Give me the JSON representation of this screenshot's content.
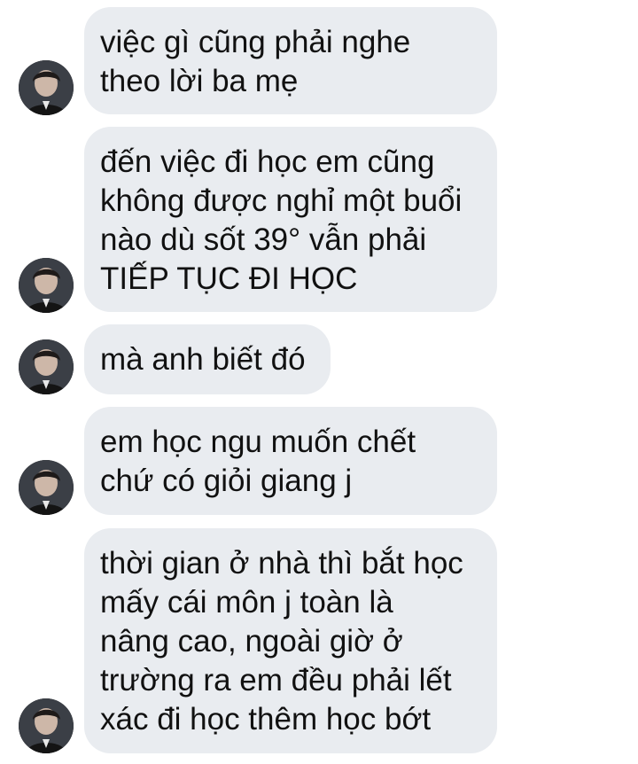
{
  "conversation": {
    "messages": [
      {
        "text": "việc gì cũng phải nghe\ntheo lời ba mẹ",
        "avatar_icon": "user-avatar-icon"
      },
      {
        "text": "đến việc đi học em cũng\nkhông được nghỉ một buổi\nnào dù sốt 39° vẫn phải\nTIẾP TỤC ĐI HỌC",
        "avatar_icon": "user-avatar-icon"
      },
      {
        "text": "mà anh biết đó",
        "avatar_icon": "user-avatar-icon"
      },
      {
        "text": "em học ngu muốn chết\nchứ có giỏi giang j",
        "avatar_icon": "user-avatar-icon"
      },
      {
        "text": "thời gian ở nhà thì bắt học\nmấy cái môn j toàn là\nnâng cao, ngoài giờ ở\ntrường ra em đều phải lết\nxác đi học thêm học bớt",
        "avatar_icon": "user-avatar-icon"
      }
    ]
  },
  "colors": {
    "bubble_background": "#e9ecf0",
    "text": "#111111",
    "page_background": "#ffffff"
  }
}
